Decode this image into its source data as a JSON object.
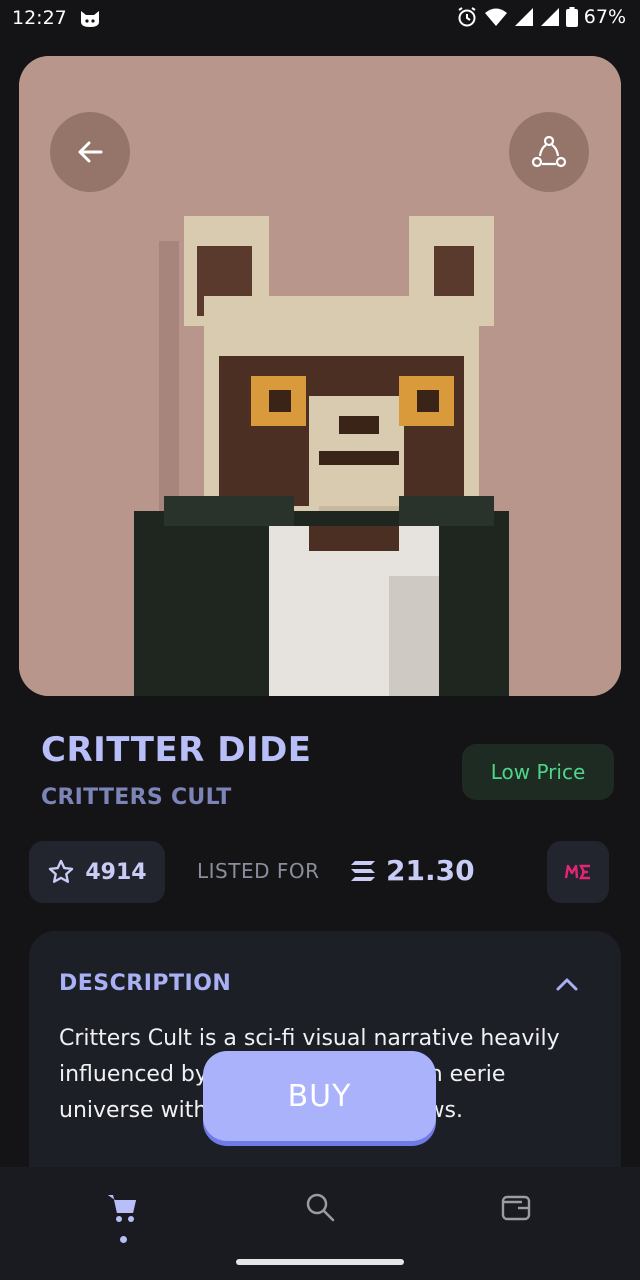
{
  "status_bar": {
    "time": "12:27",
    "battery": "67%"
  },
  "nft": {
    "name": "CRITTER DIDE",
    "collection": "CRITTERS CULT",
    "badge": "Low Price",
    "favorites": "4914",
    "listed_label": "LISTED FOR",
    "price": "21.30",
    "currency_icon": "solana-icon",
    "marketplace_icon": "magic-eden-icon"
  },
  "description": {
    "title": "DESCRIPTION",
    "text": "Critters Cult is a sci-fi visual narrative heavily influenced by 80s aesthetics, in an eerie universe with its own logic and laws."
  },
  "buy_button": {
    "label": "BUY"
  },
  "bottom_nav": {
    "items": [
      {
        "icon": "cart-icon",
        "active": true
      },
      {
        "icon": "search-icon",
        "active": false
      },
      {
        "icon": "wallet-icon",
        "active": false
      }
    ]
  },
  "colors": {
    "background": "#141416",
    "accent": "#b8bff8",
    "badge_text": "#4fd58a",
    "hero_bg": "#b9968b",
    "buy_button": "#a9b2fb"
  }
}
